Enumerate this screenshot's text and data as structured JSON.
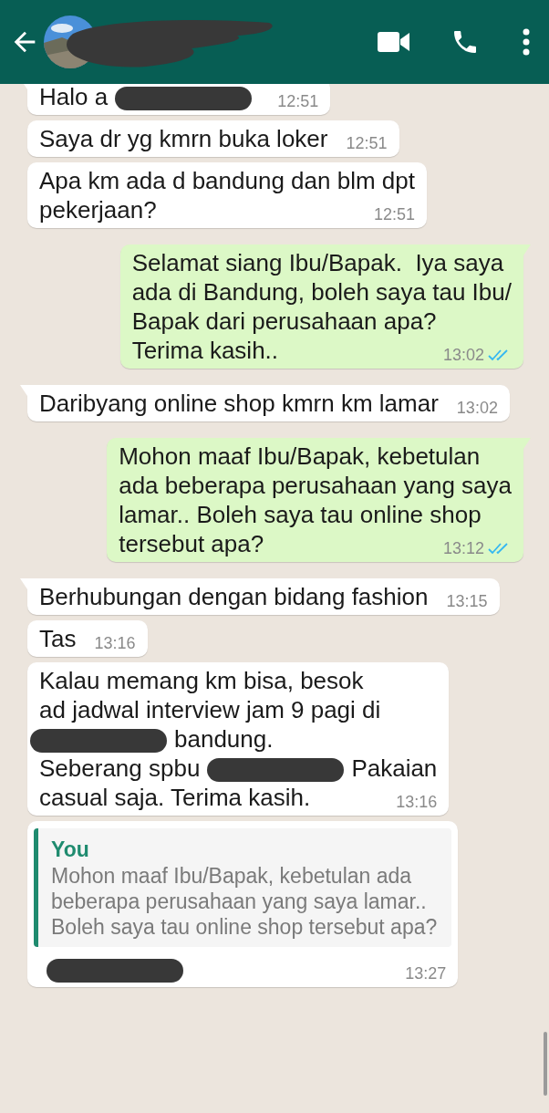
{
  "messages": [
    {
      "kind": "incoming",
      "tail": true,
      "lines": [
        [
          {
            "kind": "text",
            "text": "Halo a"
          },
          {
            "kind": "redacted"
          }
        ]
      ],
      "time": "12:51"
    },
    {
      "kind": "incoming",
      "tail": false,
      "lines": [
        [
          {
            "kind": "text",
            "text": "Saya dr yg kmrn buka loker"
          }
        ]
      ],
      "time": "12:51"
    },
    {
      "kind": "incoming",
      "tail": false,
      "lines": [
        [
          {
            "kind": "text",
            "text": "Apa km ada d bandung dan blm dpt"
          }
        ],
        [
          {
            "kind": "text",
            "text": "pekerjaan?"
          }
        ]
      ],
      "time": "12:51"
    },
    {
      "kind": "outgoing",
      "tail": true,
      "read": true,
      "lines": [
        [
          {
            "kind": "text",
            "text": "Selamat siang Ibu/Bapak.  Iya saya"
          }
        ],
        [
          {
            "kind": "text",
            "text": "ada di Bandung, boleh saya tau Ibu/"
          }
        ],
        [
          {
            "kind": "text",
            "text": "Bapak dari perusahaan apa?"
          }
        ],
        [
          {
            "kind": "text",
            "text": "Terima kasih.."
          }
        ]
      ],
      "time": "13:02"
    },
    {
      "kind": "incoming",
      "tail": true,
      "lines": [
        [
          {
            "kind": "text",
            "text": "Daribyang online shop kmrn km lamar"
          }
        ]
      ],
      "time": "13:02"
    },
    {
      "kind": "outgoing",
      "tail": true,
      "read": true,
      "lines": [
        [
          {
            "kind": "text",
            "text": "Mohon maaf Ibu/Bapak, kebetulan"
          }
        ],
        [
          {
            "kind": "text",
            "text": "ada beberapa perusahaan yang saya"
          }
        ],
        [
          {
            "kind": "text",
            "text": "lamar.. Boleh saya tau online shop"
          }
        ],
        [
          {
            "kind": "text",
            "text": "tersebut apa?"
          }
        ]
      ],
      "time": "13:12"
    },
    {
      "kind": "incoming",
      "tail": true,
      "lines": [
        [
          {
            "kind": "text",
            "text": "Berhubungan dengan bidang fashion"
          }
        ]
      ],
      "time": "13:15"
    },
    {
      "kind": "incoming",
      "tail": false,
      "lines": [
        [
          {
            "kind": "text",
            "text": "Tas"
          }
        ]
      ],
      "time": "13:16"
    },
    {
      "kind": "incoming",
      "tail": false,
      "lines": [
        [
          {
            "kind": "text",
            "text": "Kalau memang km bisa, besok"
          }
        ],
        [
          {
            "kind": "text",
            "text": "ad jadwal interview jam 9 pagi di"
          }
        ],
        [
          {
            "kind": "redacted"
          },
          {
            "kind": "text",
            "text": "bandung."
          }
        ],
        [
          {
            "kind": "text",
            "text": "Seberang spbu"
          },
          {
            "kind": "redacted"
          },
          {
            "kind": "text",
            "text": "Pakaian"
          }
        ],
        [
          {
            "kind": "text",
            "text": "casual saja. Terima kasih."
          }
        ]
      ],
      "time": "13:16"
    },
    {
      "kind": "incoming",
      "tail": false,
      "quote": {
        "author": "You",
        "lines": [
          "Mohon maaf Ibu/Bapak, kebetulan ada",
          "beberapa perusahaan yang saya lamar..",
          "Boleh saya tau online shop tersebut apa?"
        ]
      },
      "lines": [
        [
          {
            "kind": "redacted"
          }
        ]
      ],
      "time": "13:27"
    }
  ]
}
